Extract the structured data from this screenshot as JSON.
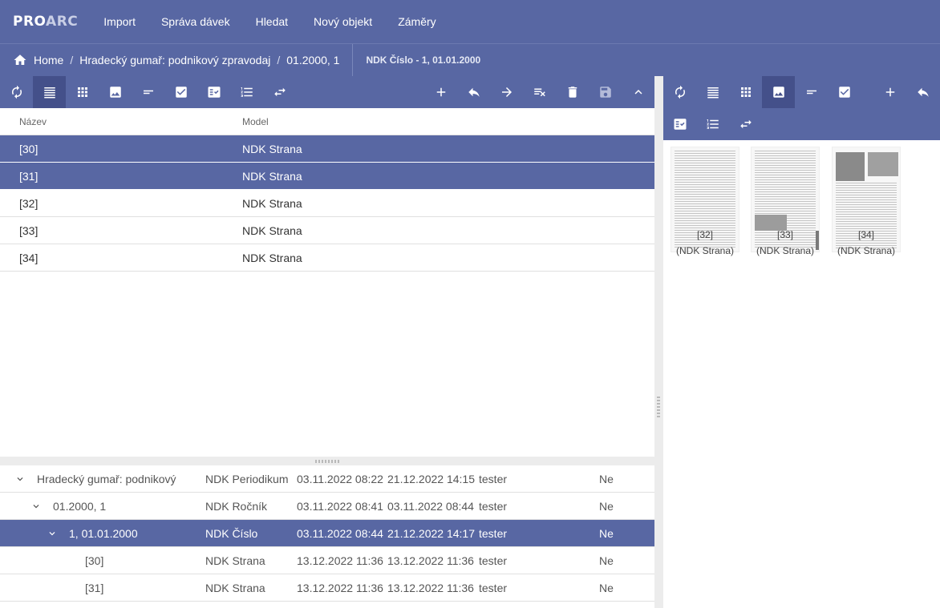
{
  "app": {
    "logo_main": "PRO",
    "logo_accent": "ARC"
  },
  "topnav": [
    "Import",
    "Správa dávek",
    "Hledat",
    "Nový objekt",
    "Záměry"
  ],
  "breadcrumb": {
    "items": [
      "Home",
      "Hradecký gumař: podnikový zpravodaj",
      "01.2000, 1"
    ],
    "current_title": "NDK Číslo - 1, 01.01.2000"
  },
  "left_grid": {
    "columns": [
      "Název",
      "Model"
    ],
    "rows": [
      {
        "name": "[30]",
        "model": "NDK Strana",
        "selected": true
      },
      {
        "name": "[31]",
        "model": "NDK Strana",
        "selected": true
      },
      {
        "name": "[32]",
        "model": "NDK Strana",
        "selected": false
      },
      {
        "name": "[33]",
        "model": "NDK Strana",
        "selected": false
      },
      {
        "name": "[34]",
        "model": "NDK Strana",
        "selected": false
      }
    ]
  },
  "tree": [
    {
      "label": "Hradecký gumař: podnikový",
      "model": "NDK Periodikum",
      "created": "03.11.2022 08:22",
      "modified": "21.12.2022 14:15",
      "owner": "tester",
      "locked": "Ne",
      "expanded": true
    },
    {
      "label": "01.2000, 1",
      "model": "NDK Ročník",
      "created": "03.11.2022 08:41",
      "modified": "03.11.2022 08:44",
      "owner": "tester",
      "locked": "Ne",
      "expanded": true
    },
    {
      "label": "1, 01.01.2000",
      "model": "NDK Číslo",
      "created": "03.11.2022 08:44",
      "modified": "21.12.2022 14:17",
      "owner": "tester",
      "locked": "Ne",
      "expanded": true
    },
    {
      "label": "[30]",
      "model": "NDK Strana",
      "created": "13.12.2022 11:36",
      "modified": "13.12.2022 11:36",
      "owner": "tester",
      "locked": "Ne"
    },
    {
      "label": "[31]",
      "model": "NDK Strana",
      "created": "13.12.2022 11:36",
      "modified": "13.12.2022 11:36",
      "owner": "tester",
      "locked": "Ne"
    }
  ],
  "thumbnails": [
    {
      "name": "[32]",
      "model": "(NDK Strana)"
    },
    {
      "name": "[33]",
      "model": "(NDK Strana)"
    },
    {
      "name": "[34]",
      "model": "(NDK Strana)"
    }
  ],
  "colors": {
    "primary": "#5867a3",
    "primary_dark": "#44508a"
  }
}
